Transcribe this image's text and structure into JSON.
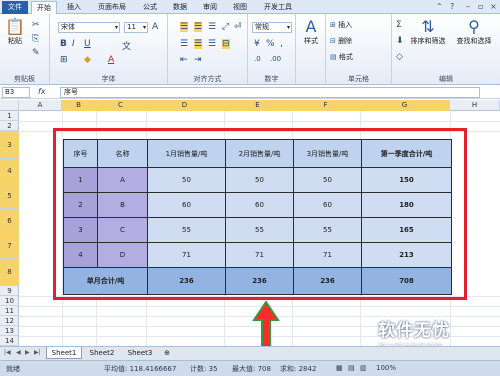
{
  "menu": {
    "file": "文件",
    "tabs": [
      "开始",
      "插入",
      "页面布局",
      "公式",
      "数据",
      "审阅",
      "视图",
      "开发工具"
    ]
  },
  "ribbon": {
    "clipboard": {
      "paste": "粘贴",
      "label": "剪贴板"
    },
    "font": {
      "font_name": "宋体",
      "font_size": "11",
      "label": "字体"
    },
    "alignment": {
      "label": "对齐方式"
    },
    "number": {
      "format": "常规",
      "percent": "%",
      "comma": ",",
      "label": "数字"
    },
    "styles": {
      "label": "样式"
    },
    "cells": {
      "insert": "插入",
      "delete": "删除",
      "format": "格式",
      "label": "单元格"
    },
    "editing": {
      "sort": "排序和筛选",
      "find": "查找和选择",
      "label": "编辑",
      "sigma": "Σ"
    }
  },
  "formula_bar": {
    "name_box": "B3",
    "fx": "fx",
    "content": "序号"
  },
  "columns": [
    "A",
    "B",
    "C",
    "D",
    "E",
    "F",
    "G",
    "H"
  ],
  "rows": [
    "1",
    "2",
    "3",
    "4",
    "5",
    "6",
    "7",
    "8",
    "9",
    "10",
    "11",
    "12",
    "13",
    "14",
    "15"
  ],
  "table": {
    "headers": [
      "序号",
      "名称",
      "1月销售量/吨",
      "2月销售量/吨",
      "3月销售量/吨",
      "第一季度合计/吨"
    ],
    "rows": [
      [
        "1",
        "A",
        "50",
        "50",
        "50",
        "150"
      ],
      [
        "2",
        "B",
        "60",
        "60",
        "60",
        "180"
      ],
      [
        "3",
        "C",
        "55",
        "55",
        "55",
        "165"
      ],
      [
        "4",
        "D",
        "71",
        "71",
        "71",
        "213"
      ]
    ],
    "total": [
      "单月合计/吨",
      "236",
      "236",
      "236",
      "708"
    ]
  },
  "sheet_tabs": [
    "Sheet1",
    "Sheet2",
    "Sheet3"
  ],
  "status": {
    "ready": "就绪",
    "average": "平均值: 118.4166667",
    "count": "计数: 35",
    "max": "最大值: 708",
    "sum": "求和: 2842",
    "zoom": "100%"
  },
  "watermark": {
    "main": "软件无忧",
    "sub": "努力解决软件问题"
  },
  "colors": {
    "highlight": "#e0232a",
    "header_fill": "#bfd3ef",
    "total_fill": "#93b3e0",
    "arrow": "#ff2a2a"
  }
}
